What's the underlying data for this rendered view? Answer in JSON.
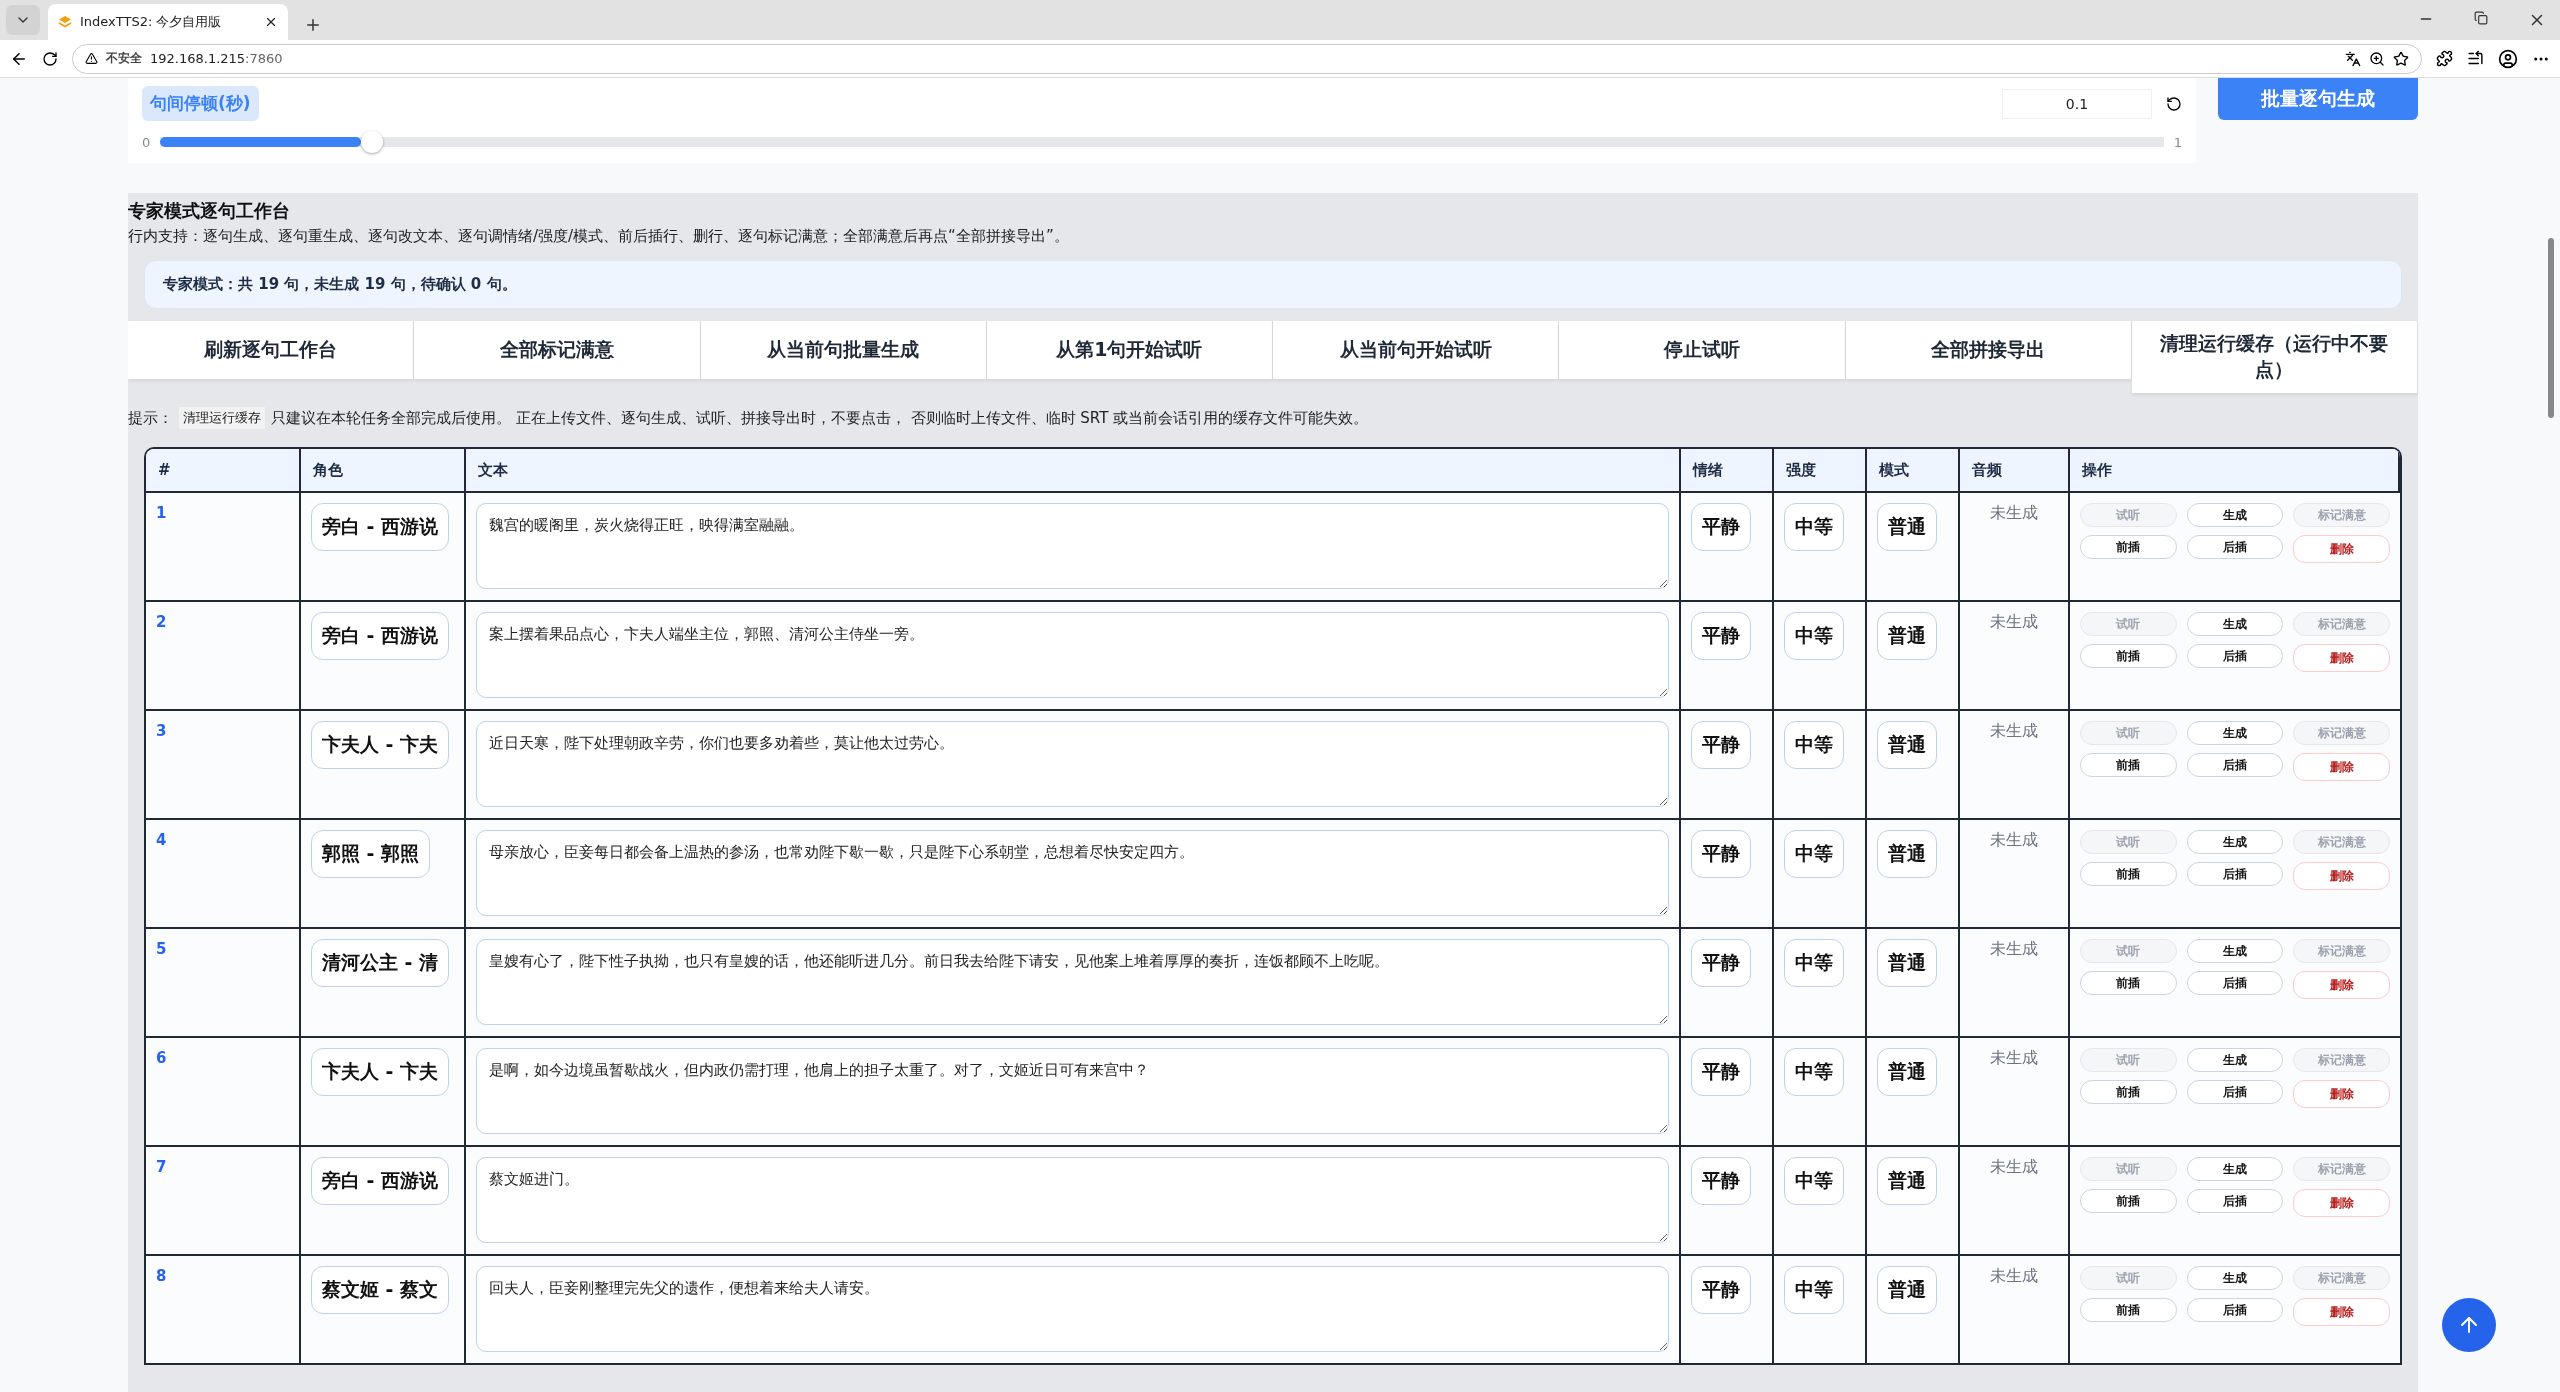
{
  "browser": {
    "tab_title": "IndexTTS2: 今夕自用版",
    "security": "不安全",
    "url_host": "192.168.1.215",
    "url_port": ":7860"
  },
  "pause": {
    "label": "句间停顿(秒)",
    "value": "0.1",
    "min": "0",
    "max": "1",
    "level": 0.1
  },
  "batch_button": "批量逐句生成",
  "workbench": {
    "title": "专家模式逐句工作台",
    "description": "行内支持：逐句生成、逐句重生成、逐句改文本、逐句调情绪/强度/模式、前后插行、删行、逐句标记满意；全部满意后再点“全部拼接导出”。",
    "stats": "专家模式：共 19 句，未生成 19 句，待确认 0 句。",
    "actions": [
      "刷新逐句工作台",
      "全部标记满意",
      "从当前句批量生成",
      "从第1句开始试听",
      "从当前句开始试听",
      "停止试听",
      "全部拼接导出",
      "清理运行缓存（运行中不要点）"
    ],
    "hint": {
      "prefix": "提示：",
      "code": "清理运行缓存",
      "rest": "只建议在本轮任务全部完成后使用。 正在上传文件、逐句生成、试听、拼接导出时，不要点击， 否则临时上传文件、临时 SRT 或当前会话引用的缓存文件可能失效。"
    }
  },
  "table": {
    "columns": [
      "#",
      "角色",
      "文本",
      "情绪",
      "强度",
      "模式",
      "音频",
      "操作"
    ],
    "rows": [
      {
        "n": "1",
        "role": "旁白 - 西游说",
        "text": "魏宫的暖阁里，炭火烧得正旺，映得满室融融。",
        "emotion": "平静",
        "intensity": "中等",
        "mode": "普通",
        "audio": "未生成",
        "ops": [
          {
            "label": "试听",
            "kind": "plain",
            "disabled": true
          },
          {
            "label": "生成",
            "kind": "plain",
            "disabled": false
          },
          {
            "label": "标记满意",
            "kind": "plain",
            "disabled": true
          },
          {
            "label": "前插",
            "kind": "plain",
            "disabled": false
          },
          {
            "label": "后插",
            "kind": "plain",
            "disabled": false
          },
          {
            "label": "删除",
            "kind": "danger",
            "disabled": false
          }
        ]
      },
      {
        "n": "2",
        "role": "旁白 - 西游说",
        "text": "案上摆着果品点心，卞夫人端坐主位，郭照、清河公主侍坐一旁。",
        "emotion": "平静",
        "intensity": "中等",
        "mode": "普通",
        "audio": "未生成",
        "ops": [
          {
            "label": "试听",
            "kind": "plain",
            "disabled": true
          },
          {
            "label": "生成",
            "kind": "plain",
            "disabled": false
          },
          {
            "label": "标记满意",
            "kind": "plain",
            "disabled": true
          },
          {
            "label": "前插",
            "kind": "plain",
            "disabled": false
          },
          {
            "label": "后插",
            "kind": "plain",
            "disabled": false
          },
          {
            "label": "删除",
            "kind": "danger",
            "disabled": false
          }
        ]
      },
      {
        "n": "3",
        "role": "卞夫人 - 卞夫",
        "text": "近日天寒，陛下处理朝政辛劳，你们也要多劝着些，莫让他太过劳心。",
        "emotion": "平静",
        "intensity": "中等",
        "mode": "普通",
        "audio": "未生成",
        "ops": [
          {
            "label": "试听",
            "kind": "plain",
            "disabled": true
          },
          {
            "label": "生成",
            "kind": "plain",
            "disabled": false
          },
          {
            "label": "标记满意",
            "kind": "plain",
            "disabled": true
          },
          {
            "label": "前插",
            "kind": "plain",
            "disabled": false
          },
          {
            "label": "后插",
            "kind": "plain",
            "disabled": false
          },
          {
            "label": "删除",
            "kind": "danger",
            "disabled": false
          }
        ]
      },
      {
        "n": "4",
        "role": "郭照 - 郭照",
        "text": "母亲放心，臣妾每日都会备上温热的参汤，也常劝陛下歇一歇，只是陛下心系朝堂，总想着尽快安定四方。",
        "emotion": "平静",
        "intensity": "中等",
        "mode": "普通",
        "audio": "未生成",
        "ops": [
          {
            "label": "试听",
            "kind": "plain",
            "disabled": true
          },
          {
            "label": "生成",
            "kind": "plain",
            "disabled": false
          },
          {
            "label": "标记满意",
            "kind": "plain",
            "disabled": true
          },
          {
            "label": "前插",
            "kind": "plain",
            "disabled": false
          },
          {
            "label": "后插",
            "kind": "plain",
            "disabled": false
          },
          {
            "label": "删除",
            "kind": "danger",
            "disabled": false
          }
        ]
      },
      {
        "n": "5",
        "role": "清河公主 - 清",
        "text": "皇嫂有心了，陛下性子执拗，也只有皇嫂的话，他还能听进几分。前日我去给陛下请安，见他案上堆着厚厚的奏折，连饭都顾不上吃呢。",
        "emotion": "平静",
        "intensity": "中等",
        "mode": "普通",
        "audio": "未生成",
        "ops": [
          {
            "label": "试听",
            "kind": "plain",
            "disabled": true
          },
          {
            "label": "生成",
            "kind": "plain",
            "disabled": false
          },
          {
            "label": "标记满意",
            "kind": "plain",
            "disabled": true
          },
          {
            "label": "前插",
            "kind": "plain",
            "disabled": false
          },
          {
            "label": "后插",
            "kind": "plain",
            "disabled": false
          },
          {
            "label": "删除",
            "kind": "danger",
            "disabled": false
          }
        ]
      },
      {
        "n": "6",
        "role": "卞夫人 - 卞夫",
        "text": "是啊，如今边境虽暂歇战火，但内政仍需打理，他肩上的担子太重了。对了，文姬近日可有来宫中？",
        "emotion": "平静",
        "intensity": "中等",
        "mode": "普通",
        "audio": "未生成",
        "ops": [
          {
            "label": "试听",
            "kind": "plain",
            "disabled": true
          },
          {
            "label": "生成",
            "kind": "plain",
            "disabled": false
          },
          {
            "label": "标记满意",
            "kind": "plain",
            "disabled": true
          },
          {
            "label": "前插",
            "kind": "plain",
            "disabled": false
          },
          {
            "label": "后插",
            "kind": "plain",
            "disabled": false
          },
          {
            "label": "删除",
            "kind": "danger",
            "disabled": false
          }
        ]
      },
      {
        "n": "7",
        "role": "旁白 - 西游说",
        "text": "蔡文姬进门。",
        "emotion": "平静",
        "intensity": "中等",
        "mode": "普通",
        "audio": "未生成",
        "ops": [
          {
            "label": "试听",
            "kind": "plain",
            "disabled": true
          },
          {
            "label": "生成",
            "kind": "plain",
            "disabled": false
          },
          {
            "label": "标记满意",
            "kind": "plain",
            "disabled": true
          },
          {
            "label": "前插",
            "kind": "plain",
            "disabled": false
          },
          {
            "label": "后插",
            "kind": "plain",
            "disabled": false
          },
          {
            "label": "删除",
            "kind": "danger",
            "disabled": false
          }
        ]
      },
      {
        "n": "8",
        "role": "蔡文姬 - 蔡文",
        "text": "回夫人，臣妾刚整理完先父的遗作，便想着来给夫人请安。",
        "emotion": "平静",
        "intensity": "中等",
        "mode": "普通",
        "audio": "未生成",
        "ops": [
          {
            "label": "试听",
            "kind": "plain",
            "disabled": true
          },
          {
            "label": "生成",
            "kind": "plain",
            "disabled": false
          },
          {
            "label": "标记满意",
            "kind": "plain",
            "disabled": true
          },
          {
            "label": "前插",
            "kind": "plain",
            "disabled": false
          },
          {
            "label": "后插",
            "kind": "plain",
            "disabled": false
          },
          {
            "label": "删除",
            "kind": "danger",
            "disabled": false
          }
        ]
      }
    ]
  }
}
